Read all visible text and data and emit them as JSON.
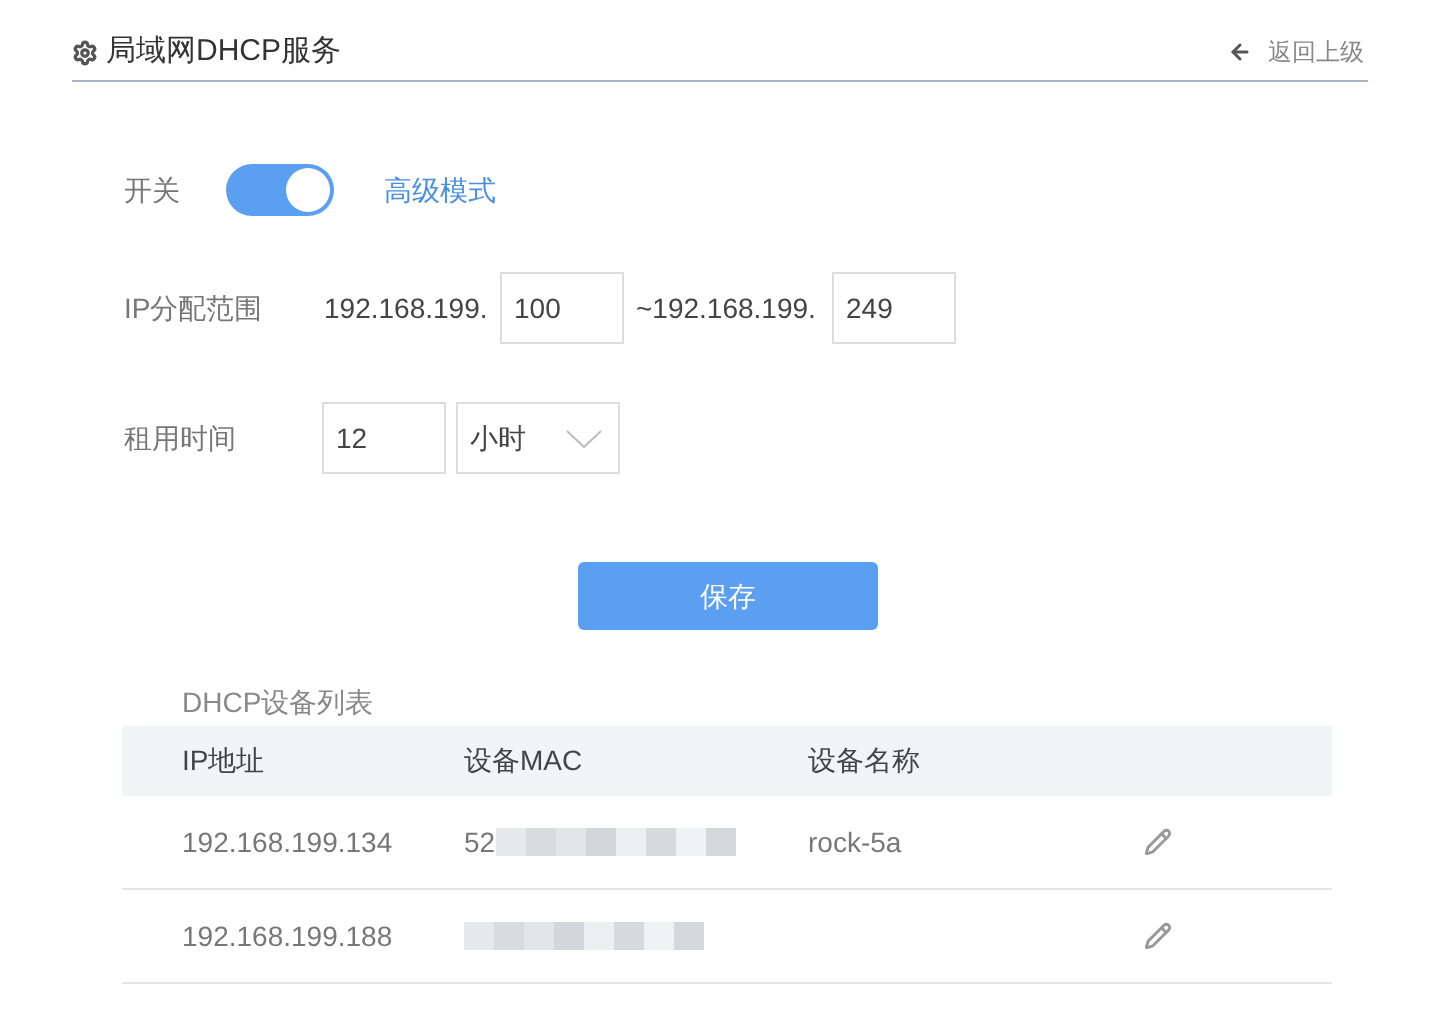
{
  "header": {
    "title": "局域网DHCP服务",
    "back": "返回上级"
  },
  "switch": {
    "label": "开关",
    "on": true,
    "link": "高级模式"
  },
  "range": {
    "label": "IP分配范围",
    "prefix_start": "192.168.199.",
    "start": "100",
    "prefix_end": "~192.168.199.",
    "end": "249"
  },
  "lease": {
    "label": "租用时间",
    "value": "12",
    "unit": "小时"
  },
  "save_button": "保存",
  "table": {
    "title": "DHCP设备列表",
    "columns": [
      "IP地址",
      "设备MAC",
      "设备名称"
    ],
    "rows": [
      {
        "ip": "192.168.199.134",
        "mac": "52",
        "mac_redacted": true,
        "name": "rock-5a"
      },
      {
        "ip": "192.168.199.188",
        "mac_redacted": true
      }
    ]
  }
}
